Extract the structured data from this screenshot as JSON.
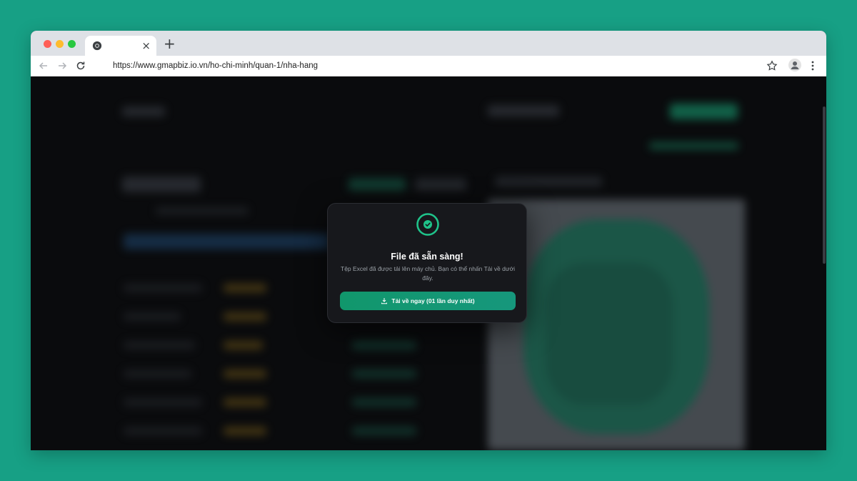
{
  "browser": {
    "tab_close": "×",
    "new_tab": "+",
    "url": "https://www.gmapbiz.io.vn/ho-chi-minh/quan-1/nha-hang"
  },
  "icons": {
    "favicon": "chrome-icon",
    "back": "back-arrow-icon",
    "forward": "forward-arrow-icon",
    "reload": "reload-icon",
    "bookmark": "star-icon",
    "profile": "profile-icon",
    "menu": "kebab-menu-icon",
    "success": "check-circle-icon",
    "download": "download-icon"
  },
  "colors": {
    "desktop_bg": "#17a085",
    "accent": "#11976c",
    "modal_bg": "#17181c",
    "success_ring": "#1fc38a"
  },
  "modal": {
    "title": "File đã sẵn sàng!",
    "description": "Tệp Excel đã được tải lên máy chủ. Bạn có thể nhấn Tải về dưới đây.",
    "download_button": "Tải về ngay (01 lần duy nhất)"
  }
}
